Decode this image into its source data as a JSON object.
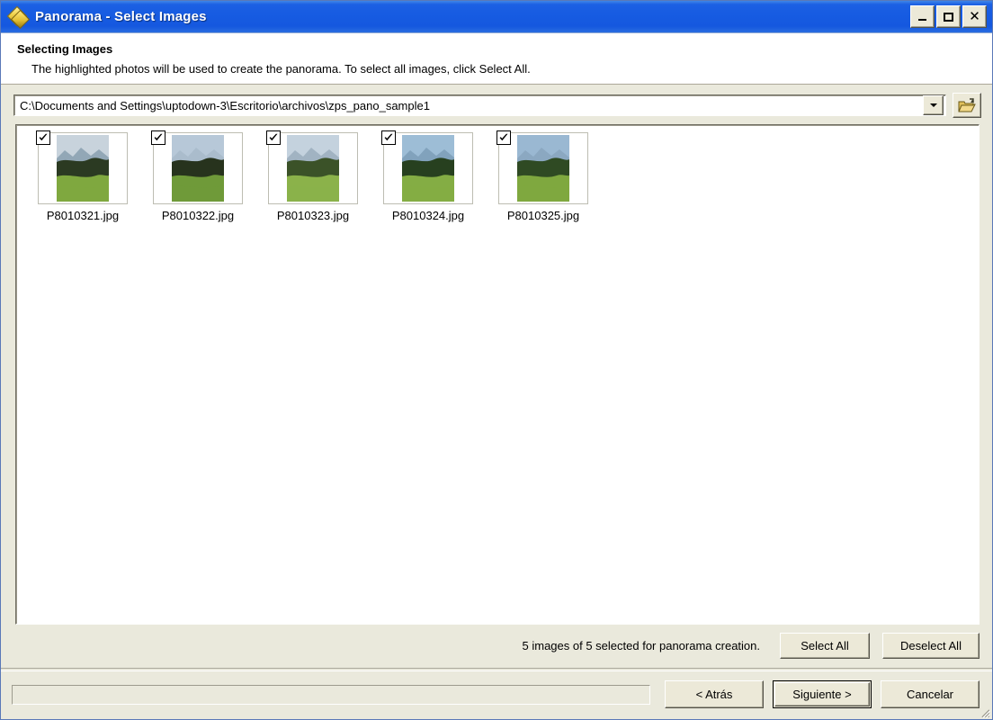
{
  "window": {
    "title": "Panorama - Select Images",
    "icon": "diamond-icon",
    "controls": {
      "minimize": "minimize-icon",
      "maximize": "maximize-icon",
      "close": "close-icon"
    },
    "accent_color": "#1558df",
    "face_color": "#eae9dc"
  },
  "header": {
    "title": "Selecting Images",
    "description": "The highlighted photos will be used to create the panorama. To select all images, click Select All."
  },
  "path_bar": {
    "value": "C:\\Documents and Settings\\uptodown-3\\Escritorio\\archivos\\zps_pano_sample1",
    "dropdown_icon": "chevron-down-icon",
    "browse_icon": "open-folder-icon"
  },
  "files": [
    {
      "name": "P8010321.jpg",
      "checked": true,
      "sky": "#c8d3dc",
      "mountain": "#8fa4b3",
      "forest": "#2b3a22",
      "meadow": "#7fa83f"
    },
    {
      "name": "P8010322.jpg",
      "checked": true,
      "sky": "#b7c8d8",
      "mountain": "#a9bccb",
      "forest": "#27331d",
      "meadow": "#6f9a39"
    },
    {
      "name": "P8010323.jpg",
      "checked": true,
      "sky": "#c4d2de",
      "mountain": "#9fb1c0",
      "forest": "#3b5228",
      "meadow": "#8bb24a"
    },
    {
      "name": "P8010324.jpg",
      "checked": true,
      "sky": "#9dbdd6",
      "mountain": "#7fa0bb",
      "forest": "#27401f",
      "meadow": "#84ad44"
    },
    {
      "name": "P8010325.jpg",
      "checked": true,
      "sky": "#9ab8d2",
      "mountain": "#8aa7c0",
      "forest": "#2f4a23",
      "meadow": "#7fa83f"
    }
  ],
  "status": {
    "text": "5 images of 5 selected for panorama creation.",
    "selected_count": 5,
    "total_count": 5,
    "select_all_label": "Select All",
    "deselect_all_label": "Deselect All"
  },
  "footer": {
    "progress_value": 0,
    "back_label": "< Atrás",
    "next_label": "Siguiente >",
    "cancel_label": "Cancelar",
    "resize_grip": "resize-grip-icon"
  }
}
